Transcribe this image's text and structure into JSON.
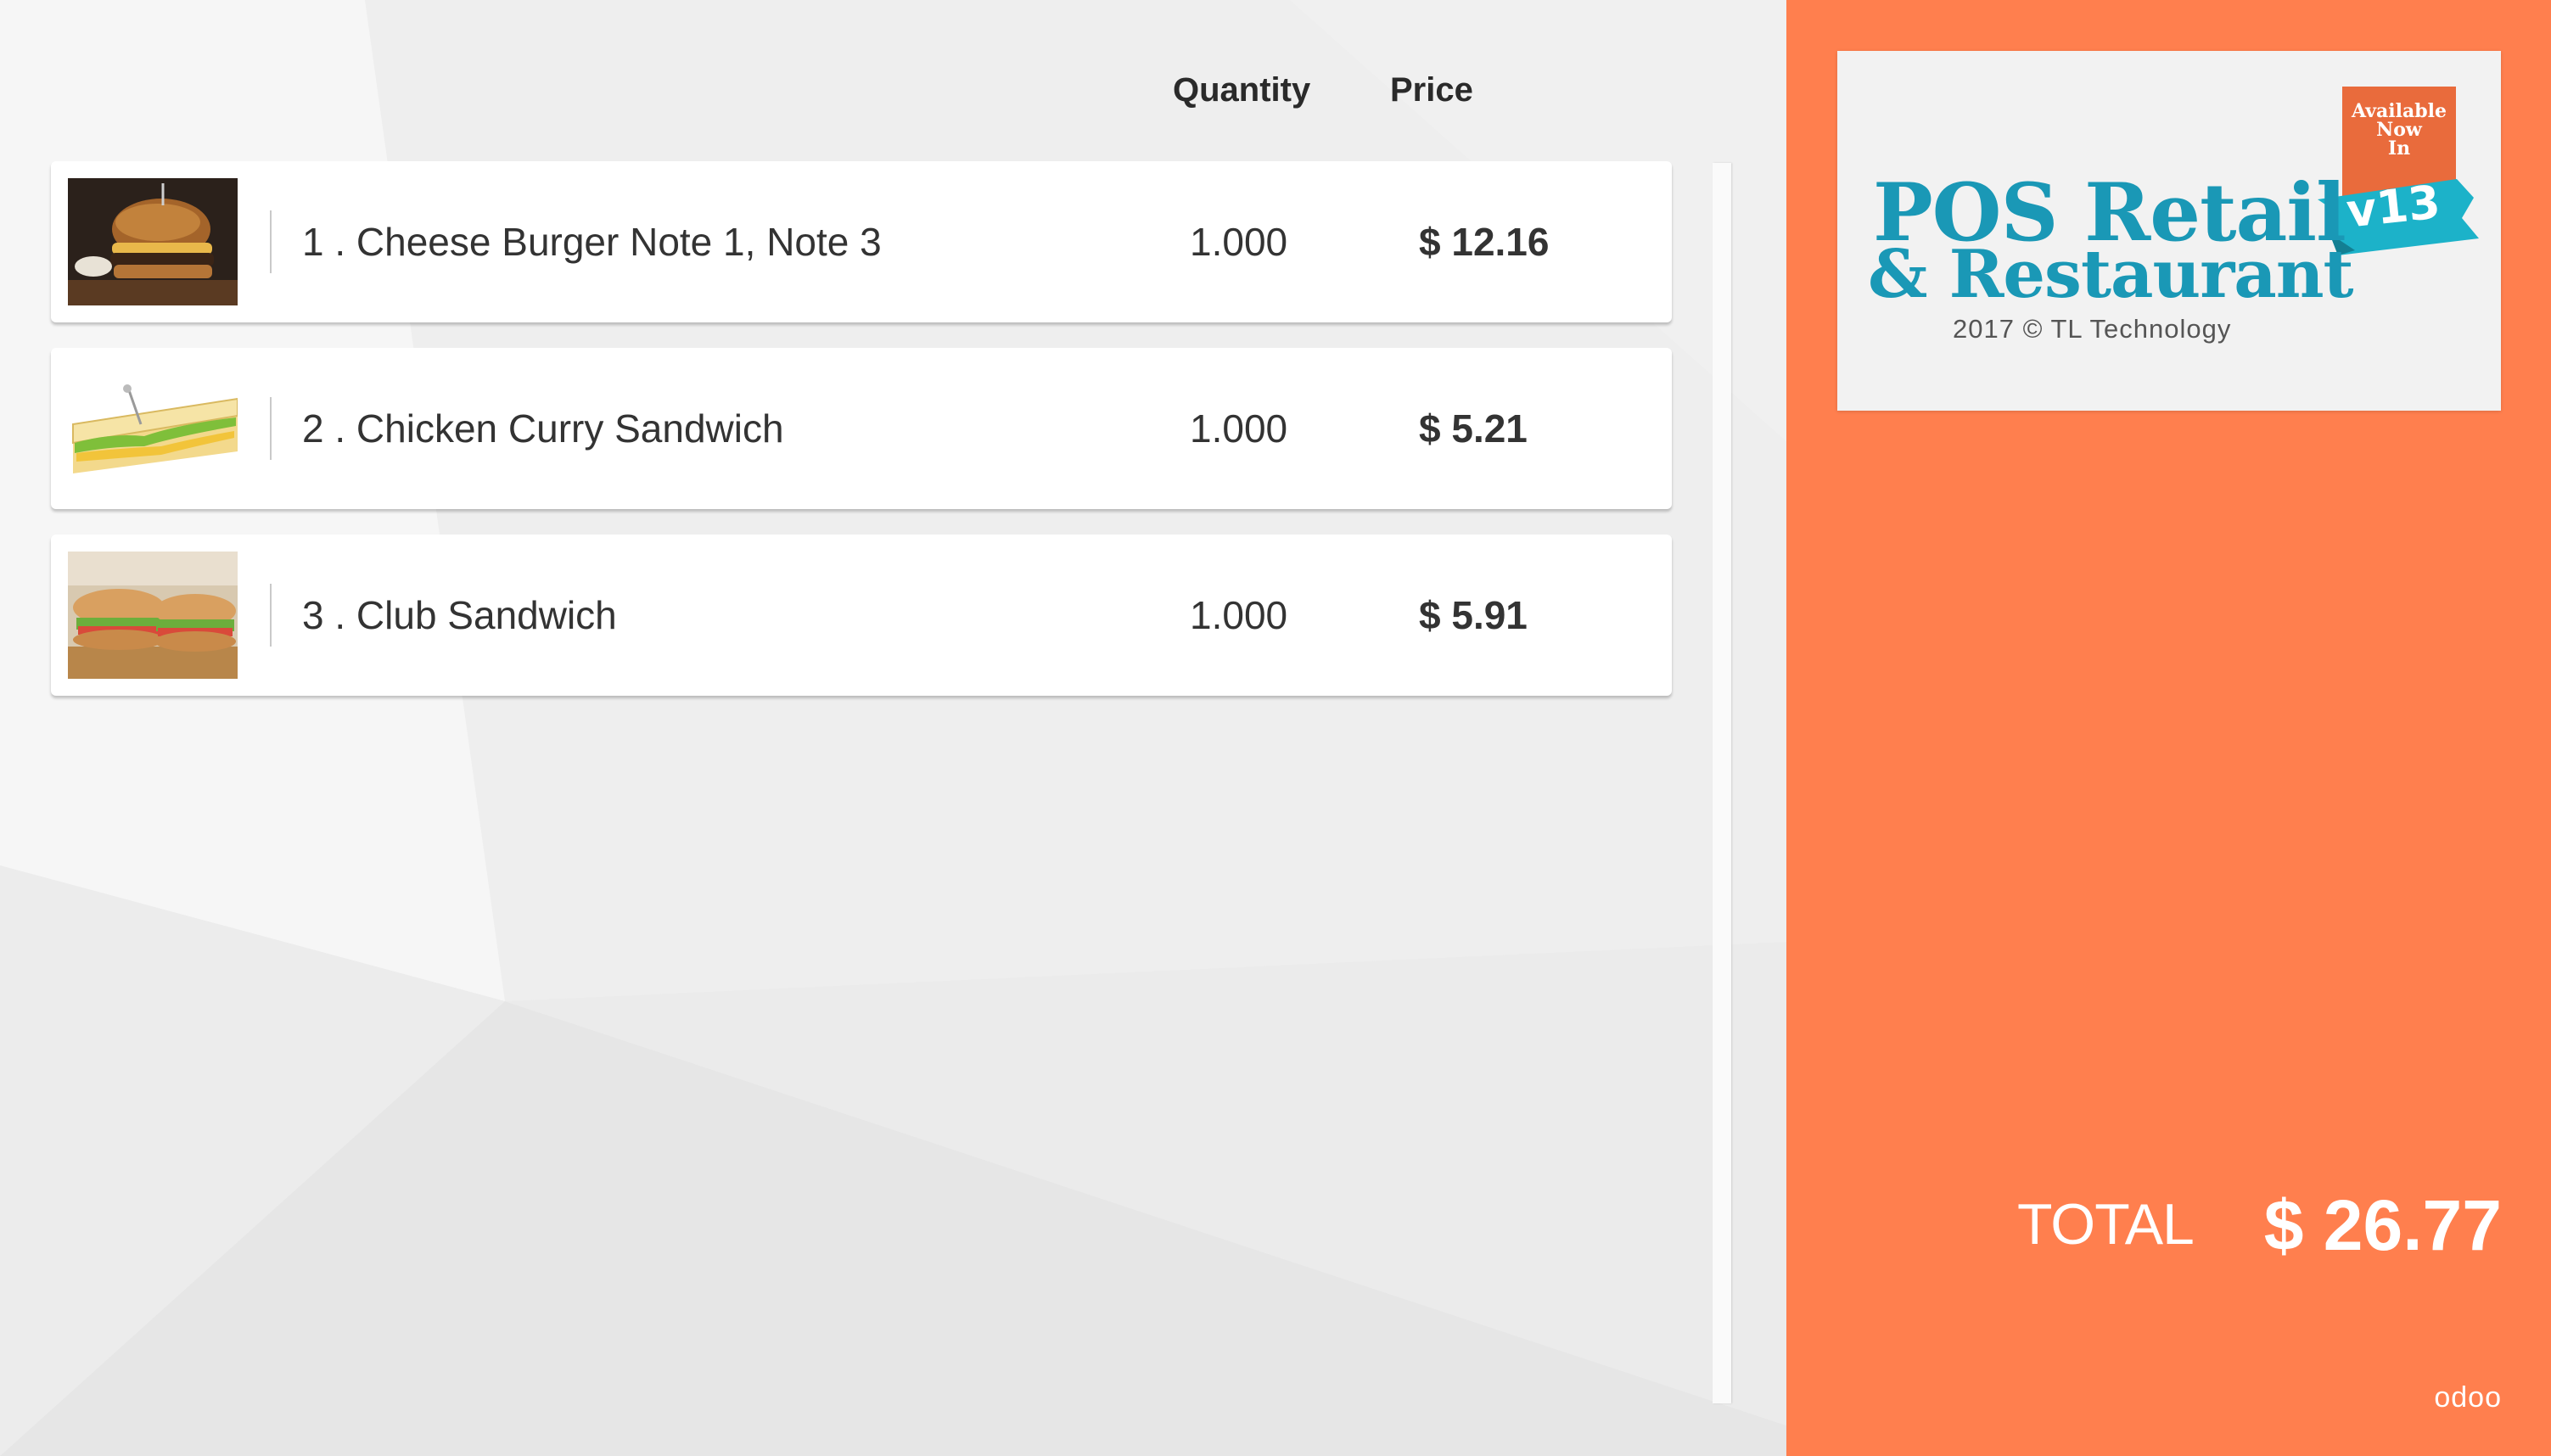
{
  "order": {
    "columns": {
      "quantity": "Quantity",
      "price": "Price"
    },
    "lines": [
      {
        "name": "1 . Cheese Burger Note 1, Note 3",
        "quantity": "1.000",
        "price": "$ 12.16",
        "image_icon": "burger-image"
      },
      {
        "name": "2 . Chicken Curry Sandwich",
        "quantity": "1.000",
        "price": "$ 5.21",
        "image_icon": "sandwich-image"
      },
      {
        "name": "3 . Club Sandwich",
        "quantity": "1.000",
        "price": "$ 5.91",
        "image_icon": "club-sandwich-image"
      }
    ]
  },
  "promo": {
    "badge": "Available Now In",
    "version": "v13",
    "title_line1": "POS Retail",
    "title_line2": "& Restaurant",
    "copyright": "2017 © TL Technology"
  },
  "total": {
    "label": "TOTAL",
    "value": "$ 26.77"
  },
  "brand": "odoo",
  "colors": {
    "panel": "#ff7f4e",
    "promo_title": "#1a98b6",
    "badge": "#e96b3c",
    "ribbon": "#1cb2c9"
  }
}
